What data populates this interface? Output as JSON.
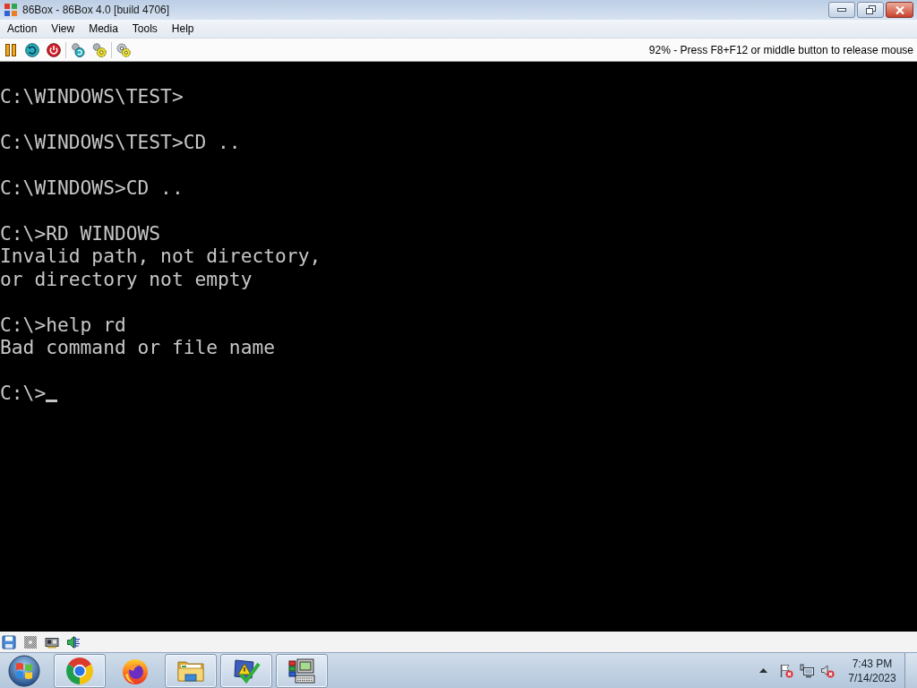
{
  "window": {
    "title": "86Box - 86Box 4.0 [build 4706]",
    "maximized": true
  },
  "menu": [
    "Action",
    "View",
    "Media",
    "Tools",
    "Help"
  ],
  "toolbar": {
    "groups": [
      [
        {
          "kind": "pause"
        },
        {
          "kind": "reset"
        },
        {
          "kind": "power"
        }
      ],
      [
        {
          "kind": "ctrl_alt_del"
        },
        {
          "kind": "ctrl_alt_esc"
        }
      ],
      [
        {
          "kind": "settings"
        }
      ]
    ],
    "status_text": "92% - Press F8+F12 or middle button to release mouse"
  },
  "screen": {
    "blocks": [
      {
        "lines": [
          "C:\\WINDOWS\\TEST>"
        ]
      },
      {
        "lines": [
          "C:\\WINDOWS\\TEST>CD .."
        ]
      },
      {
        "lines": [
          "C:\\WINDOWS>CD .."
        ]
      },
      {
        "lines": [
          "C:\\>RD WINDOWS",
          "Invalid path, not directory,",
          "or directory not empty"
        ]
      },
      {
        "lines": [
          "C:\\>help rd",
          "Bad command or file name"
        ]
      },
      {
        "lines": [
          "C:\\>"
        ]
      }
    ],
    "cursor": true
  },
  "status_bar": {
    "icons": [
      {
        "kind": "floppy"
      },
      {
        "kind": "cdrom"
      },
      {
        "kind": "network"
      },
      {
        "kind": "sound"
      }
    ]
  },
  "taskbar": {
    "apps": [
      {
        "kind": "ring",
        "running": true
      },
      {
        "kind": "fox",
        "running": false
      },
      {
        "kind": "folder",
        "running": true
      },
      {
        "kind": "check",
        "running": true
      },
      {
        "kind": "computer",
        "running": true
      }
    ],
    "tray": [
      {
        "kind": "flag"
      },
      {
        "kind": "network"
      },
      {
        "kind": "volume"
      }
    ],
    "clock": {
      "time": "7:43 PM",
      "date": "7/14/2023"
    }
  }
}
